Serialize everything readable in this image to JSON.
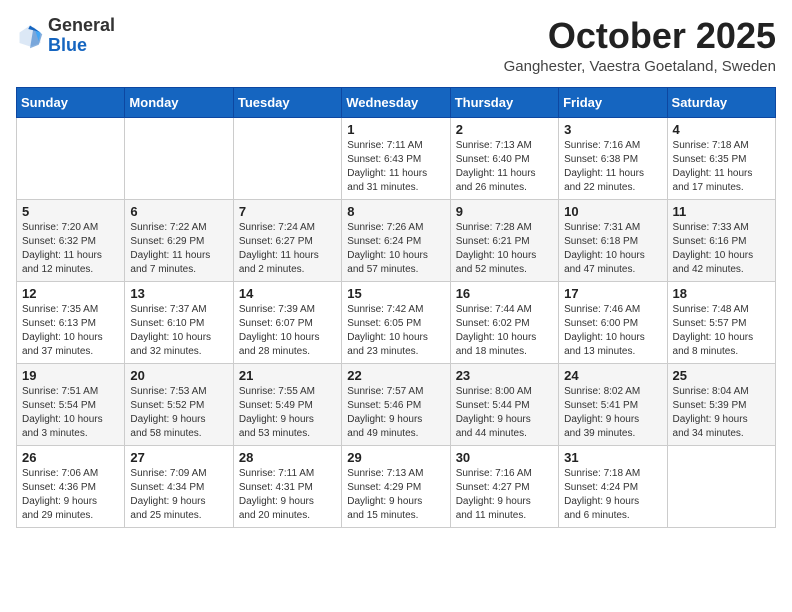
{
  "logo": {
    "general": "General",
    "blue": "Blue"
  },
  "title": "October 2025",
  "subtitle": "Ganghester, Vaestra Goetaland, Sweden",
  "weekdays": [
    "Sunday",
    "Monday",
    "Tuesday",
    "Wednesday",
    "Thursday",
    "Friday",
    "Saturday"
  ],
  "weeks": [
    [
      {
        "day": "",
        "info": ""
      },
      {
        "day": "",
        "info": ""
      },
      {
        "day": "",
        "info": ""
      },
      {
        "day": "1",
        "info": "Sunrise: 7:11 AM\nSunset: 6:43 PM\nDaylight: 11 hours\nand 31 minutes."
      },
      {
        "day": "2",
        "info": "Sunrise: 7:13 AM\nSunset: 6:40 PM\nDaylight: 11 hours\nand 26 minutes."
      },
      {
        "day": "3",
        "info": "Sunrise: 7:16 AM\nSunset: 6:38 PM\nDaylight: 11 hours\nand 22 minutes."
      },
      {
        "day": "4",
        "info": "Sunrise: 7:18 AM\nSunset: 6:35 PM\nDaylight: 11 hours\nand 17 minutes."
      }
    ],
    [
      {
        "day": "5",
        "info": "Sunrise: 7:20 AM\nSunset: 6:32 PM\nDaylight: 11 hours\nand 12 minutes."
      },
      {
        "day": "6",
        "info": "Sunrise: 7:22 AM\nSunset: 6:29 PM\nDaylight: 11 hours\nand 7 minutes."
      },
      {
        "day": "7",
        "info": "Sunrise: 7:24 AM\nSunset: 6:27 PM\nDaylight: 11 hours\nand 2 minutes."
      },
      {
        "day": "8",
        "info": "Sunrise: 7:26 AM\nSunset: 6:24 PM\nDaylight: 10 hours\nand 57 minutes."
      },
      {
        "day": "9",
        "info": "Sunrise: 7:28 AM\nSunset: 6:21 PM\nDaylight: 10 hours\nand 52 minutes."
      },
      {
        "day": "10",
        "info": "Sunrise: 7:31 AM\nSunset: 6:18 PM\nDaylight: 10 hours\nand 47 minutes."
      },
      {
        "day": "11",
        "info": "Sunrise: 7:33 AM\nSunset: 6:16 PM\nDaylight: 10 hours\nand 42 minutes."
      }
    ],
    [
      {
        "day": "12",
        "info": "Sunrise: 7:35 AM\nSunset: 6:13 PM\nDaylight: 10 hours\nand 37 minutes."
      },
      {
        "day": "13",
        "info": "Sunrise: 7:37 AM\nSunset: 6:10 PM\nDaylight: 10 hours\nand 32 minutes."
      },
      {
        "day": "14",
        "info": "Sunrise: 7:39 AM\nSunset: 6:07 PM\nDaylight: 10 hours\nand 28 minutes."
      },
      {
        "day": "15",
        "info": "Sunrise: 7:42 AM\nSunset: 6:05 PM\nDaylight: 10 hours\nand 23 minutes."
      },
      {
        "day": "16",
        "info": "Sunrise: 7:44 AM\nSunset: 6:02 PM\nDaylight: 10 hours\nand 18 minutes."
      },
      {
        "day": "17",
        "info": "Sunrise: 7:46 AM\nSunset: 6:00 PM\nDaylight: 10 hours\nand 13 minutes."
      },
      {
        "day": "18",
        "info": "Sunrise: 7:48 AM\nSunset: 5:57 PM\nDaylight: 10 hours\nand 8 minutes."
      }
    ],
    [
      {
        "day": "19",
        "info": "Sunrise: 7:51 AM\nSunset: 5:54 PM\nDaylight: 10 hours\nand 3 minutes."
      },
      {
        "day": "20",
        "info": "Sunrise: 7:53 AM\nSunset: 5:52 PM\nDaylight: 9 hours\nand 58 minutes."
      },
      {
        "day": "21",
        "info": "Sunrise: 7:55 AM\nSunset: 5:49 PM\nDaylight: 9 hours\nand 53 minutes."
      },
      {
        "day": "22",
        "info": "Sunrise: 7:57 AM\nSunset: 5:46 PM\nDaylight: 9 hours\nand 49 minutes."
      },
      {
        "day": "23",
        "info": "Sunrise: 8:00 AM\nSunset: 5:44 PM\nDaylight: 9 hours\nand 44 minutes."
      },
      {
        "day": "24",
        "info": "Sunrise: 8:02 AM\nSunset: 5:41 PM\nDaylight: 9 hours\nand 39 minutes."
      },
      {
        "day": "25",
        "info": "Sunrise: 8:04 AM\nSunset: 5:39 PM\nDaylight: 9 hours\nand 34 minutes."
      }
    ],
    [
      {
        "day": "26",
        "info": "Sunrise: 7:06 AM\nSunset: 4:36 PM\nDaylight: 9 hours\nand 29 minutes."
      },
      {
        "day": "27",
        "info": "Sunrise: 7:09 AM\nSunset: 4:34 PM\nDaylight: 9 hours\nand 25 minutes."
      },
      {
        "day": "28",
        "info": "Sunrise: 7:11 AM\nSunset: 4:31 PM\nDaylight: 9 hours\nand 20 minutes."
      },
      {
        "day": "29",
        "info": "Sunrise: 7:13 AM\nSunset: 4:29 PM\nDaylight: 9 hours\nand 15 minutes."
      },
      {
        "day": "30",
        "info": "Sunrise: 7:16 AM\nSunset: 4:27 PM\nDaylight: 9 hours\nand 11 minutes."
      },
      {
        "day": "31",
        "info": "Sunrise: 7:18 AM\nSunset: 4:24 PM\nDaylight: 9 hours\nand 6 minutes."
      },
      {
        "day": "",
        "info": ""
      }
    ]
  ]
}
